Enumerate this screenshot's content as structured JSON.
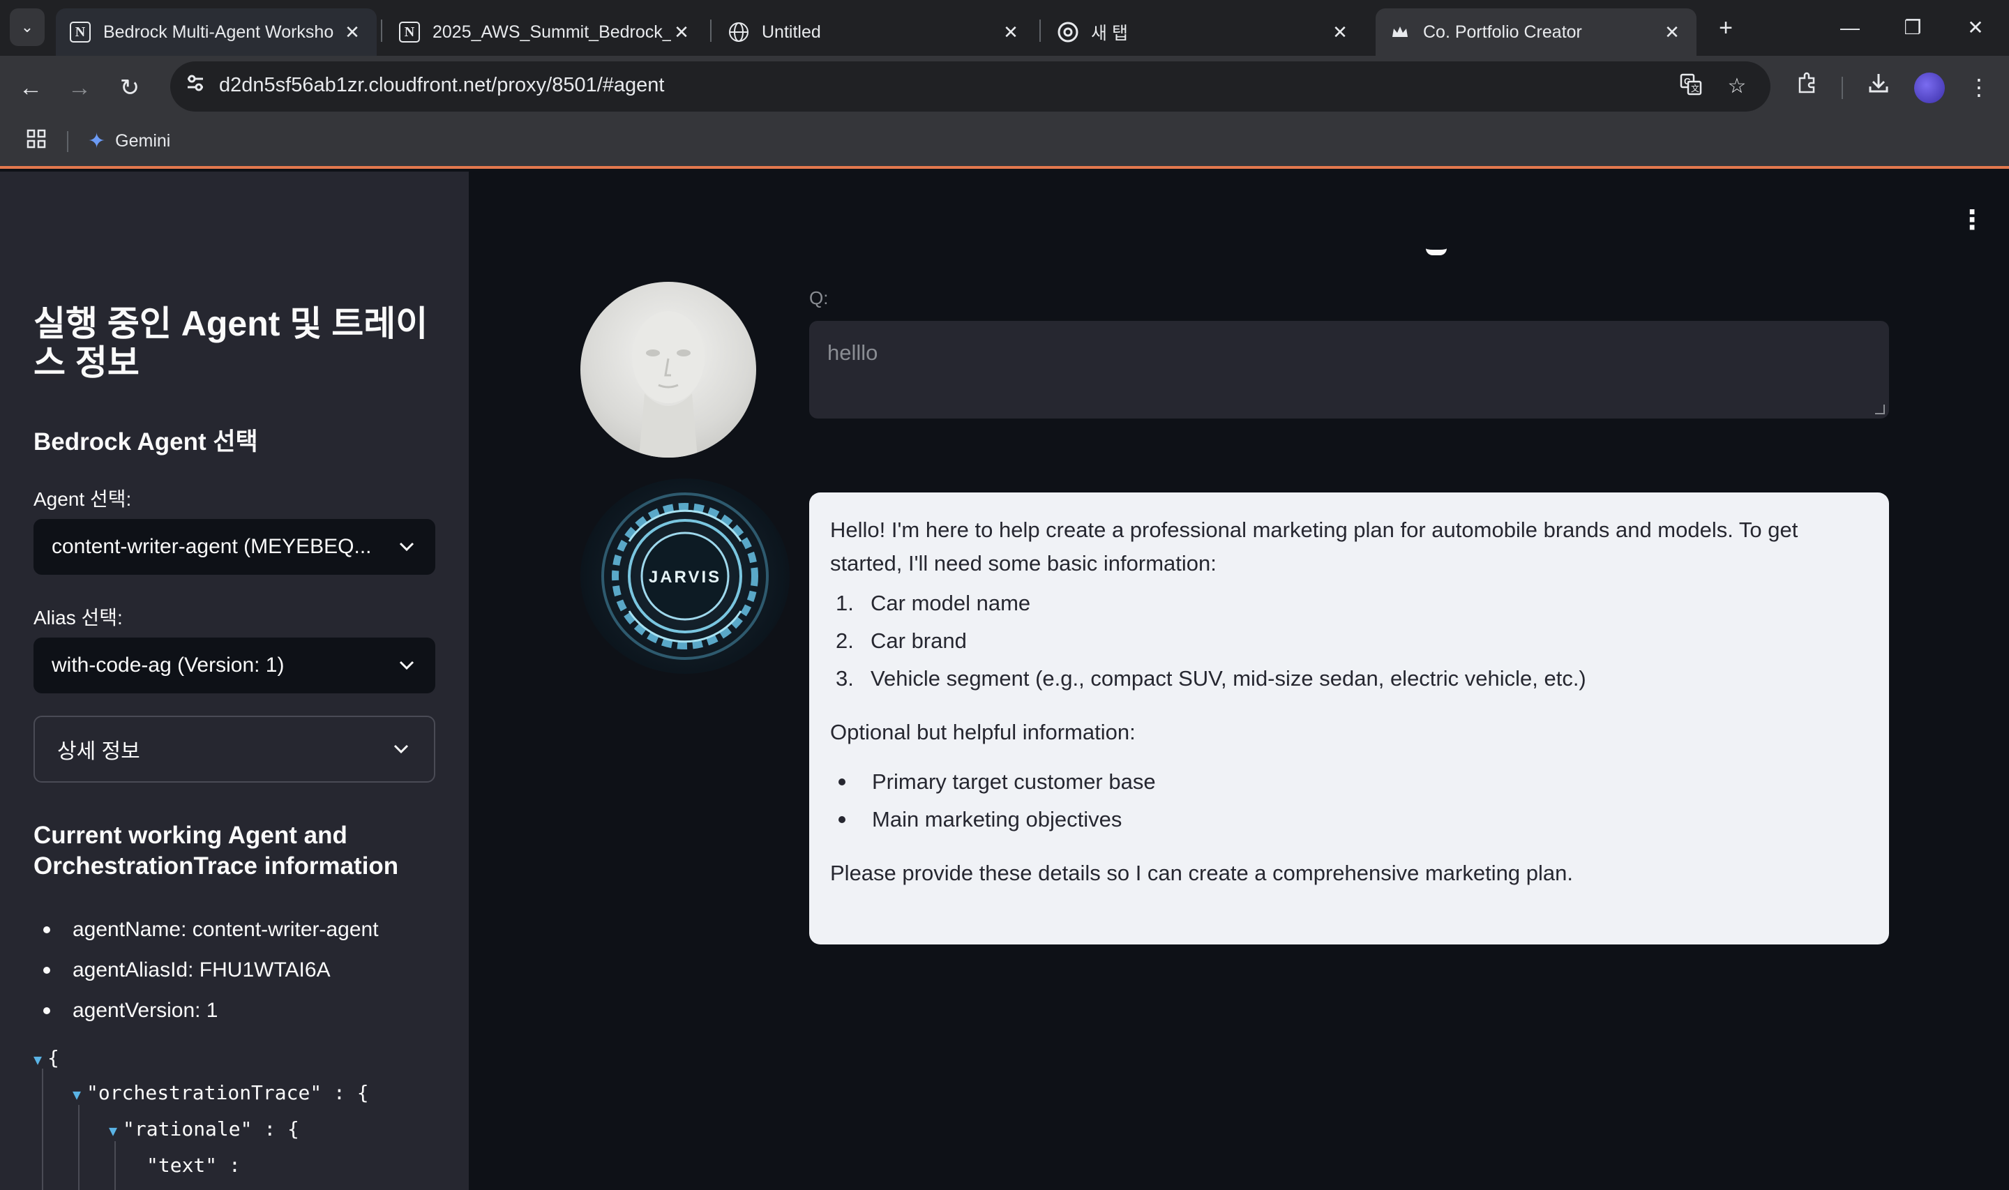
{
  "browser": {
    "tabs": [
      {
        "title": "Bedrock Multi-Agent Worksho",
        "favicon": "N"
      },
      {
        "title": "2025_AWS_Summit_Bedrock_n",
        "favicon": "N"
      },
      {
        "title": "Untitled",
        "favicon": "globe-icon"
      },
      {
        "title": "새 탭",
        "favicon": "chrome-icon"
      },
      {
        "title": "Co. Portfolio Creator",
        "favicon": "crown-icon"
      }
    ],
    "url": "d2dn5sf56ab1zr.cloudfront.net/proxy/8501/#agent",
    "bookmarks": [
      {
        "label": "Gemini"
      }
    ],
    "accent_color": "#e3784d"
  },
  "sidebar": {
    "title": "실행 중인 Agent 및 트레이스 정보",
    "agent_section_heading": "Bedrock Agent 선택",
    "agent_label": "Agent 선택:",
    "agent_value": "content-writer-agent (MEYEBEQ...",
    "alias_label": "Alias 선택:",
    "alias_value": "with-code-ag (Version: 1)",
    "details_expander": "상세 정보",
    "trace_heading": "Current working Agent and OrchestrationTrace information",
    "trace_items": [
      "agentName: content-writer-agent",
      "agentAliasId: FHU1WTAI6A",
      "agentVersion: 1"
    ],
    "json_lines": [
      "{",
      "\"orchestrationTrace\" : {",
      "\"rationale\" : {",
      "\"text\" :"
    ]
  },
  "main": {
    "question_label": "Q:",
    "question_text": "helllo",
    "answer": {
      "intro": "Hello! I'm here to help create a professional marketing plan for automobile brands and models. To get started, I'll need some basic information:",
      "required": [
        "Car model name",
        "Car brand",
        "Vehicle segment (e.g., compact SUV, mid-size sedan, electric vehicle, etc.)"
      ],
      "optional_heading": "Optional but helpful information:",
      "optional": [
        "Primary target customer base",
        "Main marketing objectives"
      ],
      "closing": "Please provide these details so I can create a comprehensive marketing plan."
    },
    "bot_avatar_text": "JARVIS"
  }
}
